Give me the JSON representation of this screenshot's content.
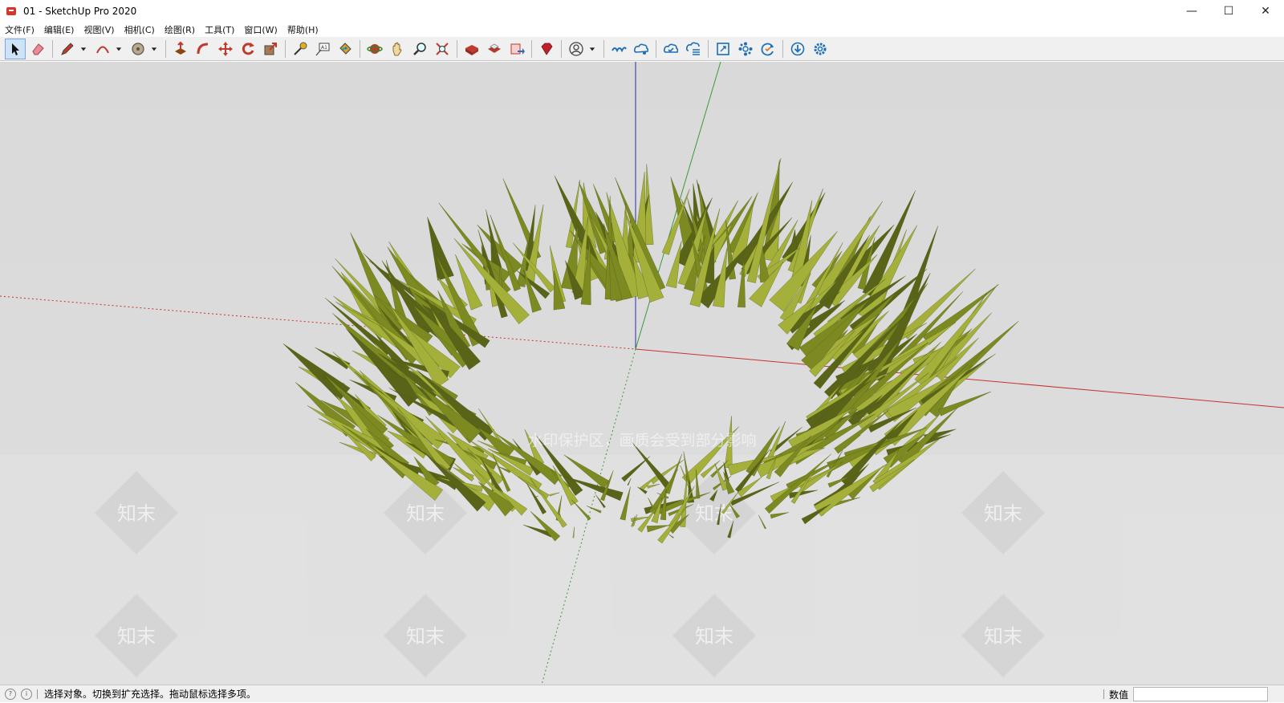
{
  "window": {
    "title": "01 - SketchUp Pro 2020",
    "controls": {
      "minimize": "—",
      "maximize": "☐",
      "close": "✕"
    }
  },
  "menu": [
    {
      "label": "文件(F)"
    },
    {
      "label": "编辑(E)"
    },
    {
      "label": "视图(V)"
    },
    {
      "label": "相机(C)"
    },
    {
      "label": "绘图(R)"
    },
    {
      "label": "工具(T)"
    },
    {
      "label": "窗口(W)"
    },
    {
      "label": "帮助(H)"
    }
  ],
  "toolbar": {
    "tools": [
      "select-icon",
      "eraser-icon",
      "pencil-icon",
      "arc-icon",
      "circle-icon",
      "push-pull-icon",
      "follow-me-icon",
      "move-icon",
      "rotate-icon",
      "scale-icon",
      "tape-measure-icon",
      "text-icon",
      "paint-bucket-icon",
      "orbit-icon",
      "pan-icon",
      "zoom-icon",
      "zoom-extents-icon",
      "3d-warehouse-icon",
      "extension-warehouse-icon",
      "layout-icon",
      "ruby-icon",
      "account-icon",
      "trimble-connect-icon",
      "trimble-share-icon",
      "cloud-sync-icon",
      "cloud-list-icon",
      "viewport-icon",
      "components-icon",
      "refresh-icon",
      "download-icon",
      "settings-icon"
    ]
  },
  "scene": {
    "watermark": "水印保护区，画质会受到部分影响",
    "watermark_tile": "知末",
    "axis_colors": {
      "blue": "#2a2aa8",
      "green": "#3a9a3a",
      "red": "#c83232"
    },
    "grass_colors": {
      "dark": "#5a6418",
      "mid": "#7d8a22",
      "light": "#a4b03a"
    }
  },
  "status": {
    "message": "选择对象。切换到扩充选择。拖动鼠标选择多项。",
    "measure_label": "数值",
    "measure_value": ""
  },
  "colors": {
    "toolbar_bg": "#f0f0f0",
    "viewport_bg": "#dadada",
    "active_tool": "#cfe3f7"
  }
}
